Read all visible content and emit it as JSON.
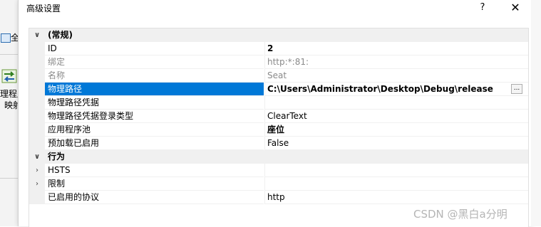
{
  "background_app": {
    "top_button_label": "全",
    "item_label": "理程序映射"
  },
  "dialog": {
    "title": "高级设置",
    "help_label": "?",
    "close_label": "✕"
  },
  "properties": {
    "categories": {
      "general": "(常规)",
      "behavior": "行为"
    },
    "rows": {
      "id": {
        "name": "ID",
        "value": "2"
      },
      "bindings": {
        "name": "绑定",
        "value": "http:*:81:"
      },
      "site_name": {
        "name": "名称",
        "value": "Seat"
      },
      "physical_path": {
        "name": "物理路径",
        "value": "C:\\Users\\Administrator\\Desktop\\Debug\\release",
        "button": "..."
      },
      "physical_path_credentials": {
        "name": "物理路径凭据",
        "value": ""
      },
      "physical_path_logon_type": {
        "name": "物理路径凭据登录类型",
        "value": "ClearText"
      },
      "app_pool": {
        "name": "应用程序池",
        "value": "座位"
      },
      "preload_enabled": {
        "name": "预加载已启用",
        "value": "False"
      },
      "hsts": {
        "name": "HSTS",
        "value": ""
      },
      "limits": {
        "name": "限制",
        "value": ""
      },
      "enabled_protocols": {
        "name": "已启用的协议",
        "value": "http"
      }
    }
  },
  "watermark": "CSDN @黑白a分明",
  "colors": {
    "selection": "#0078d7",
    "category_bg": "#f0f0f0",
    "dim_text": "#8a8a8a"
  },
  "icons": {
    "expanded": "chevron-down-icon",
    "collapsed": "chevron-right-icon"
  }
}
